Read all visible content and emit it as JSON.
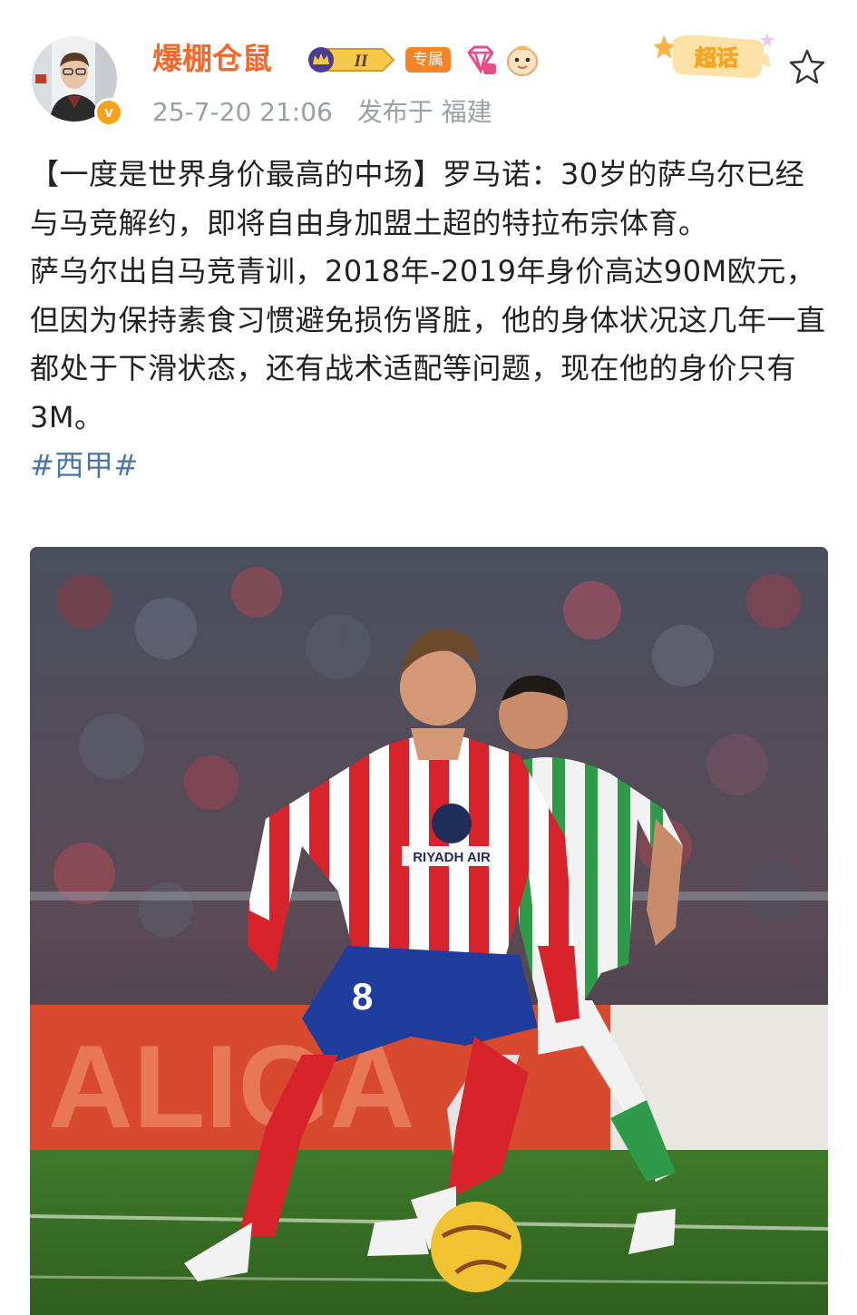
{
  "post": {
    "author": {
      "name": "爆棚仓鼠",
      "level_badge": "II",
      "tag": "专属",
      "verified": "v"
    },
    "meta": {
      "time": "25-7-20 21:06",
      "location": "发布于 福建"
    },
    "supertopic": "超话",
    "text": {
      "para1": "【一度是世界身价最高的中场】罗马诺：30岁的萨乌尔已经与马竞解约，即将自由身加盟土超的特拉布宗体育。",
      "para2": "萨乌尔出自马竞青训，2018年-2019年身价高达90M欧元，但因为保持素食习惯避免损伤肾脏，他的身体状况这几年一直都处于下滑状态，还有战术适配等问题，现在他的身价只有3M。",
      "hashtag": "#西甲#"
    },
    "photo": {
      "jersey_sponsor": "RIYADH AIR",
      "shirt_number": "8",
      "board_text": "ALIGA"
    }
  },
  "colors": {
    "username": "#f3682c",
    "hashtag": "#4b76a8",
    "meta": "#9aa0a6",
    "badge_orange": "#f58426"
  },
  "icons": [
    "crown-level-icon",
    "gem-icon",
    "mascot-icon",
    "verified-icon",
    "supertopic-icon",
    "star-icon"
  ]
}
